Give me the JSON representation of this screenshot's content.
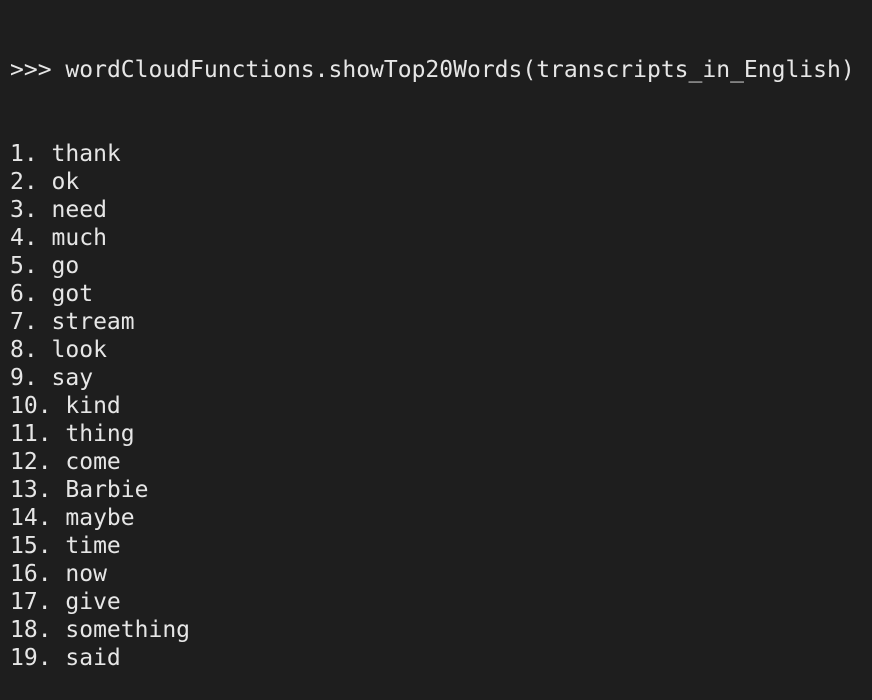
{
  "terminal": {
    "prompt": ">>>",
    "command": "wordCloudFunctions.showTop20Words(transcripts_in_English)",
    "output": [
      "1. thank",
      "2. ok",
      "3. need",
      "4. much",
      "5. go",
      "6. got",
      "7. stream",
      "8. look",
      "9. say",
      "10. kind",
      "11. thing",
      "12. come",
      "13. Barbie",
      "14. maybe",
      "15. time",
      "16. now",
      "17. give",
      "18. something",
      "19. said"
    ]
  }
}
